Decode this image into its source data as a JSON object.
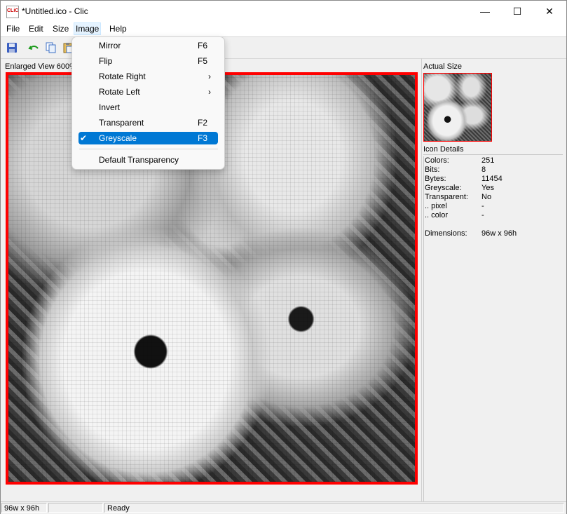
{
  "window": {
    "title": "*Untitled.ico - Clic",
    "app_icon_text": "CLiC",
    "minimize": "—",
    "maximize": "☐",
    "close": "✕"
  },
  "menubar": {
    "file": "File",
    "edit": "Edit",
    "size": "Size",
    "image": "Image",
    "help": "Help"
  },
  "toolbar": {
    "save_icon": "save-icon",
    "undo_icon": "undo-icon",
    "copy_icon": "copy-icon",
    "paste_icon": "paste-icon"
  },
  "enlarged_label": "Enlarged View 600%",
  "actual_label": "Actual Size",
  "details": {
    "header": "Icon Details",
    "rows": [
      {
        "key": "Colors:",
        "value": "251"
      },
      {
        "key": "Bits:",
        "value": "8"
      },
      {
        "key": "Bytes:",
        "value": "11454"
      },
      {
        "key": "Greyscale:",
        "value": "Yes"
      },
      {
        "key": "Transparent:",
        "value": "No"
      },
      {
        "key": ".. pixel",
        "value": "-"
      },
      {
        "key": ".. color",
        "value": "-"
      },
      {
        "key": "Dimensions:",
        "value": "96w x 96h"
      }
    ]
  },
  "image_menu": {
    "items": [
      {
        "label": "Mirror",
        "shortcut": "F6"
      },
      {
        "label": "Flip",
        "shortcut": "F5"
      },
      {
        "label": "Rotate Right",
        "shortcut": "›"
      },
      {
        "label": "Rotate Left",
        "shortcut": "›"
      },
      {
        "label": "Invert",
        "shortcut": ""
      },
      {
        "label": "Transparent",
        "shortcut": "F2"
      },
      {
        "label": "Greyscale",
        "shortcut": "F3",
        "checked": "✔"
      },
      {
        "label": "Default Transparency",
        "shortcut": ""
      }
    ]
  },
  "statusbar": {
    "dimensions": "96w x 96h",
    "middle": "",
    "status": "Ready"
  },
  "colors": {
    "accent": "#0078d4",
    "border_red": "#ff0000"
  }
}
